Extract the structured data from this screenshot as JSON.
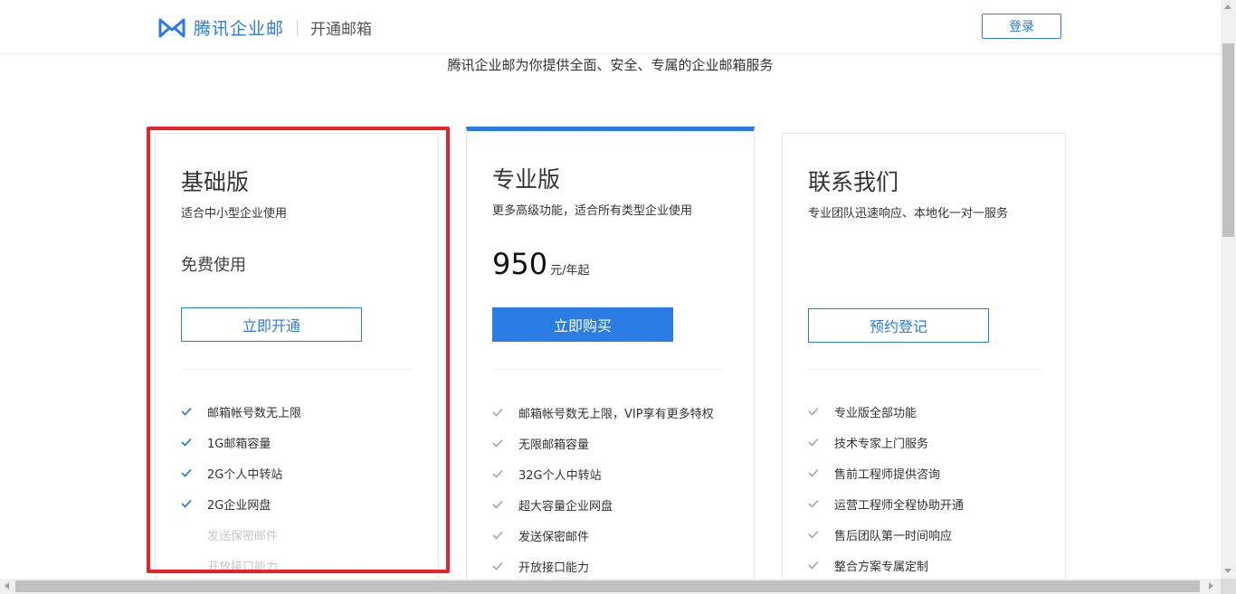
{
  "header": {
    "brand": "腾讯企业邮",
    "subtitle": "开通邮箱",
    "login_label": "登录"
  },
  "slogan": "腾讯企业邮为你提供全面、安全、专属的企业邮箱服务",
  "colors": {
    "accent": "#2b7be5",
    "highlight": "#e8232a"
  },
  "plans": {
    "basic": {
      "title": "基础版",
      "desc": "适合中小型企业使用",
      "price_text": "免费使用",
      "button": "立即开通",
      "features": [
        {
          "label": "邮箱帐号数无上限",
          "enabled": true
        },
        {
          "label": "1G邮箱容量",
          "enabled": true
        },
        {
          "label": "2G个人中转站",
          "enabled": true
        },
        {
          "label": "2G企业网盘",
          "enabled": true
        },
        {
          "label": "发送保密邮件",
          "enabled": false
        },
        {
          "label": "开放接口能力",
          "enabled": false
        }
      ]
    },
    "pro": {
      "title": "专业版",
      "desc": "更多高级功能，适合所有类型企业使用",
      "price": "950",
      "price_unit": "元/年起",
      "button": "立即购买",
      "features": [
        {
          "label": "邮箱帐号数无上限，VIP享有更多特权"
        },
        {
          "label": "无限邮箱容量"
        },
        {
          "label": "32G个人中转站"
        },
        {
          "label": "超大容量企业网盘"
        },
        {
          "label": "发送保密邮件"
        },
        {
          "label": "开放接口能力"
        }
      ]
    },
    "contact": {
      "title": "联系我们",
      "desc": "专业团队迅速响应、本地化一对一服务",
      "button": "预约登记",
      "features": [
        {
          "label": "专业版全部功能"
        },
        {
          "label": "技术专家上门服务"
        },
        {
          "label": "售前工程师提供咨询"
        },
        {
          "label": "运营工程师全程协助开通"
        },
        {
          "label": "售后团队第一时间响应"
        },
        {
          "label": "整合方案专属定制"
        }
      ]
    }
  }
}
